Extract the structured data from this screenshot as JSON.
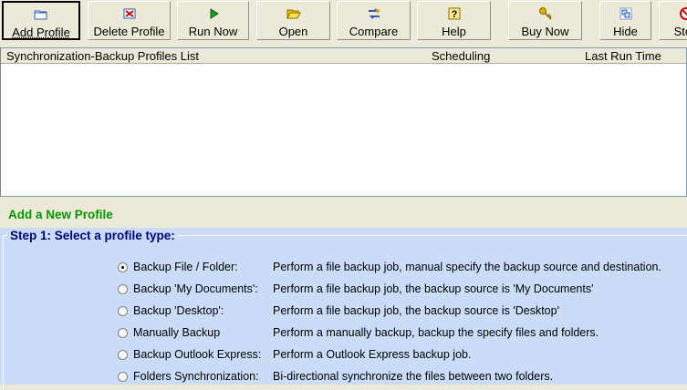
{
  "toolbar": {
    "buttons": [
      {
        "label": "Add Profile",
        "icon": "folder-icon"
      },
      {
        "label": "Delete Profile",
        "icon": "delete-profile-icon"
      },
      {
        "label": "Run Now",
        "icon": "play-icon"
      },
      {
        "label": "Open",
        "icon": "open-folder-icon"
      },
      {
        "label": "Compare",
        "icon": "compare-icon"
      },
      {
        "label": "Help",
        "icon": "help-icon"
      },
      {
        "label": "Buy Now",
        "icon": "key-icon"
      },
      {
        "label": "Hide",
        "icon": "hide-icon"
      },
      {
        "label": "Stop",
        "icon": "stop-icon"
      }
    ]
  },
  "profiles_list": {
    "columns": [
      "Synchronization-Backup Profiles List",
      "Scheduling",
      "Last Run Time"
    ],
    "rows": []
  },
  "new_profile": {
    "heading": "Add a New Profile",
    "step_title": "Step 1:   Select a profile type:",
    "options": [
      {
        "label": "Backup File / Folder:",
        "description": "Perform a file backup job, manual specify the backup source and destination.",
        "selected": true
      },
      {
        "label": "Backup 'My Documents':",
        "description": "Perform a file backup job, the backup source is 'My Documents'",
        "selected": false
      },
      {
        "label": "Backup 'Desktop':",
        "description": "Perform a file backup job, the backup source is 'Desktop'",
        "selected": false
      },
      {
        "label": "Manually Backup",
        "description": "Perform a manually backup, backup the specify files and folders.",
        "selected": false
      },
      {
        "label": "Backup Outlook Express:",
        "description": "Perform a Outlook Express backup job.",
        "selected": false
      },
      {
        "label": "Folders Synchronization:",
        "description": "Bi-directional synchronize the files between two folders.",
        "selected": false
      }
    ]
  },
  "colors": {
    "window_bg": "#ece9d8",
    "panel_bg": "#cadcf8",
    "heading_green": "#009900",
    "step_title_blue": "#00007b"
  }
}
